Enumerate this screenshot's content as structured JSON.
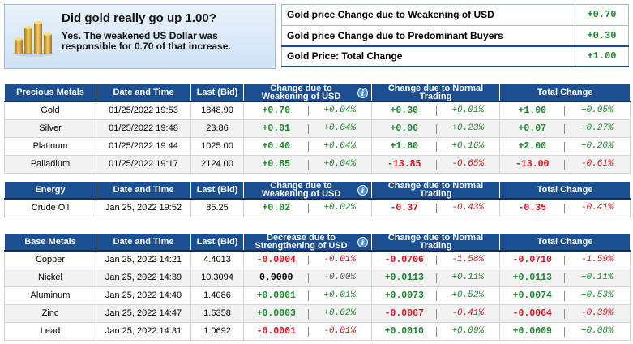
{
  "summary": {
    "question": "Did gold really go up 1.00?",
    "explanation": "Yes. The weakened US Dollar was responsible for 0.70 of that increase.",
    "image_icon": "gold-bars-icon",
    "rows": [
      {
        "label": "Gold price Change due to Weakening of USD",
        "value": "+0.70"
      },
      {
        "label": "Gold price Change due to Predominant Buyers",
        "value": "+0.30"
      },
      {
        "label": "Gold Price: Total Change",
        "value": "+1.00"
      }
    ]
  },
  "precious": {
    "headers": {
      "metal": "Precious Metals",
      "datetime": "Date and Time",
      "bid": "Last (Bid)",
      "usd": "Change due to Weakening of USD",
      "normal": "Change due to Normal Trading",
      "total": "Total Change"
    },
    "rows": [
      {
        "name": "Gold",
        "datetime": "01/25/2022 19:53",
        "bid": "1848.90",
        "usd": "+0.70",
        "usd_pct": "+0.04%",
        "normal": "+0.30",
        "normal_pct": "+0.01%",
        "total": "+1.00",
        "total_pct": "+0.05%"
      },
      {
        "name": "Silver",
        "datetime": "01/25/2022 19:48",
        "bid": "23.86",
        "usd": "+0.01",
        "usd_pct": "+0.04%",
        "normal": "+0.06",
        "normal_pct": "+0.23%",
        "total": "+0.07",
        "total_pct": "+0.27%"
      },
      {
        "name": "Platinum",
        "datetime": "01/25/2022 19:44",
        "bid": "1025.00",
        "usd": "+0.40",
        "usd_pct": "+0.04%",
        "normal": "+1.60",
        "normal_pct": "+0.16%",
        "total": "+2.00",
        "total_pct": "+0.20%"
      },
      {
        "name": "Palladium",
        "datetime": "01/25/2022 19:17",
        "bid": "2124.00",
        "usd": "+0.85",
        "usd_pct": "+0.04%",
        "normal": "-13.85",
        "normal_pct": "-0.65%",
        "total": "-13.00",
        "total_pct": "-0.61%"
      }
    ]
  },
  "energy": {
    "headers": {
      "metal": "Energy",
      "datetime": "Date and Time",
      "bid": "Last (Bid)",
      "usd": "Change due to Weakening of USD",
      "normal": "Change due to Normal Trading",
      "total": "Total Change"
    },
    "rows": [
      {
        "name": "Crude Oil",
        "datetime": "Jan 25, 2022 19:52",
        "bid": "85.25",
        "usd": "+0.02",
        "usd_pct": "+0.02%",
        "normal": "-0.37",
        "normal_pct": "-0.43%",
        "total": "-0.35",
        "total_pct": "-0.41%"
      }
    ]
  },
  "base": {
    "headers": {
      "metal": "Base Metals",
      "datetime": "Date and Time",
      "bid": "Last (Bid)",
      "usd": "Decrease due to Strengthening of USD",
      "normal": "Change due to Normal Trading",
      "total": "Total Change"
    },
    "rows": [
      {
        "name": "Copper",
        "datetime": "Jan 25, 2022 14:21",
        "bid": "4.4013",
        "usd": "-0.0004",
        "usd_pct": "-0.01%",
        "normal": "-0.0706",
        "normal_pct": "-1.58%",
        "total": "-0.0710",
        "total_pct": "-1.59%"
      },
      {
        "name": "Nickel",
        "datetime": "Jan 25, 2022 14:39",
        "bid": "10.3094",
        "usd": "0.0000",
        "usd_pct": "-0.00%",
        "normal": "+0.0113",
        "normal_pct": "+0.11%",
        "total": "+0.0113",
        "total_pct": "+0.11%"
      },
      {
        "name": "Aluminum",
        "datetime": "Jan 25, 2022 14:40",
        "bid": "1.4086",
        "usd": "+0.0001",
        "usd_pct": "+0.01%",
        "normal": "+0.0073",
        "normal_pct": "+0.52%",
        "total": "+0.0074",
        "total_pct": "+0.53%"
      },
      {
        "name": "Zinc",
        "datetime": "Jan 25, 2022 14:47",
        "bid": "1.6358",
        "usd": "+0.0003",
        "usd_pct": "+0.02%",
        "normal": "-0.0067",
        "normal_pct": "-0.41%",
        "total": "-0.0064",
        "total_pct": "-0.39%"
      },
      {
        "name": "Lead",
        "datetime": "Jan 25, 2022 14:31",
        "bid": "1.0692",
        "usd": "-0.0001",
        "usd_pct": "-0.01%",
        "normal": "+0.0010",
        "normal_pct": "+0.09%",
        "total": "+0.0009",
        "total_pct": "+0.08%"
      }
    ]
  },
  "colors": {
    "header_bg": "#1b4f91",
    "positive": "#18862a",
    "negative": "#d4121b",
    "summary_bg": "#cfe2f5"
  },
  "icons": {
    "info": "info-icon"
  }
}
